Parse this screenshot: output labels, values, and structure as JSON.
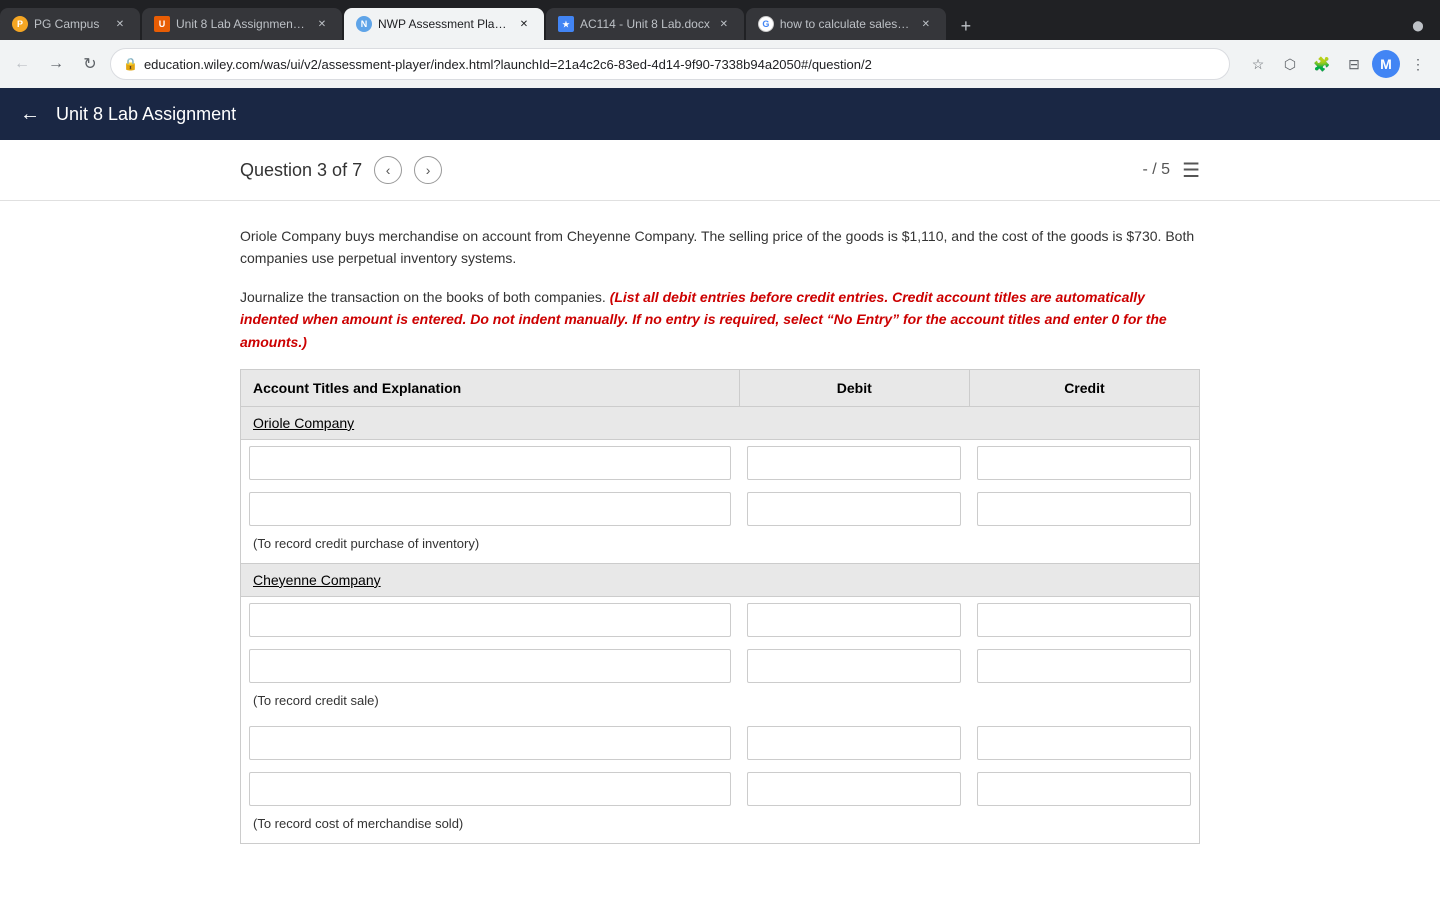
{
  "browser": {
    "tabs": [
      {
        "id": "pg-campus",
        "label": "PG Campus",
        "favicon": "pg",
        "active": false,
        "closeable": true
      },
      {
        "id": "unit8-lab",
        "label": "Unit 8 Lab Assignment - AC11…",
        "favicon": "unit",
        "active": false,
        "closeable": true
      },
      {
        "id": "nwp-player",
        "label": "NWP Assessment Player UI Ap…",
        "favicon": "nwp",
        "active": true,
        "closeable": true
      },
      {
        "id": "ac114-doc",
        "label": "AC114 - Unit 8 Lab.docx",
        "favicon": "ac",
        "active": false,
        "closeable": true
      },
      {
        "id": "google-search",
        "label": "how to calculate sales revenue",
        "favicon": "google",
        "active": false,
        "closeable": true
      }
    ],
    "url": "education.wiley.com/was/ui/v2/assessment-player/index.html?launchId=21a4c2c6-83ed-4d14-9f90-7338b94a2050#/question/2",
    "profile_initial": "M"
  },
  "app_header": {
    "back_label": "←",
    "title": "Unit 8 Lab Assignment"
  },
  "question_nav": {
    "label": "Question 3 of 7",
    "prev_arrow": "‹",
    "next_arrow": "›",
    "score": "- / 5"
  },
  "question": {
    "body": "Oriole Company buys merchandise on account from Cheyenne Company. The selling price of the goods is $1,110, and the cost of the goods is $730. Both companies use perpetual inventory systems.",
    "instruction_plain": "Journalize the transaction on the books of both companies. ",
    "instruction_red": "(List all debit entries before credit entries. Credit account titles are automatically indented when amount is entered. Do not indent manually. If no entry is required, select “No Entry” for the account titles and enter 0 for the amounts.)"
  },
  "table": {
    "col_account": "Account Titles and Explanation",
    "col_debit": "Debit",
    "col_credit": "Credit",
    "sections": [
      {
        "id": "oriole",
        "section_label": "Oriole Company",
        "rows": [
          {
            "id": "oriole-row1",
            "account_val": "",
            "debit_val": "",
            "credit_val": ""
          },
          {
            "id": "oriole-row2",
            "account_val": "",
            "debit_val": "",
            "credit_val": ""
          }
        ],
        "note": "(To record credit purchase of inventory)"
      },
      {
        "id": "cheyenne",
        "section_label": "Cheyenne Company",
        "rows": [
          {
            "id": "cheyenne-row1",
            "account_val": "",
            "debit_val": "",
            "credit_val": ""
          },
          {
            "id": "cheyenne-row2",
            "account_val": "",
            "debit_val": "",
            "credit_val": ""
          }
        ],
        "note": "(To record credit sale)"
      },
      {
        "id": "cheyenne2",
        "section_label": null,
        "rows": [
          {
            "id": "cheyenne2-row1",
            "account_val": "",
            "debit_val": "",
            "credit_val": ""
          },
          {
            "id": "cheyenne2-row2",
            "account_val": "",
            "debit_val": "",
            "credit_val": ""
          }
        ],
        "note": "(To record cost of merchandise sold)"
      }
    ]
  }
}
